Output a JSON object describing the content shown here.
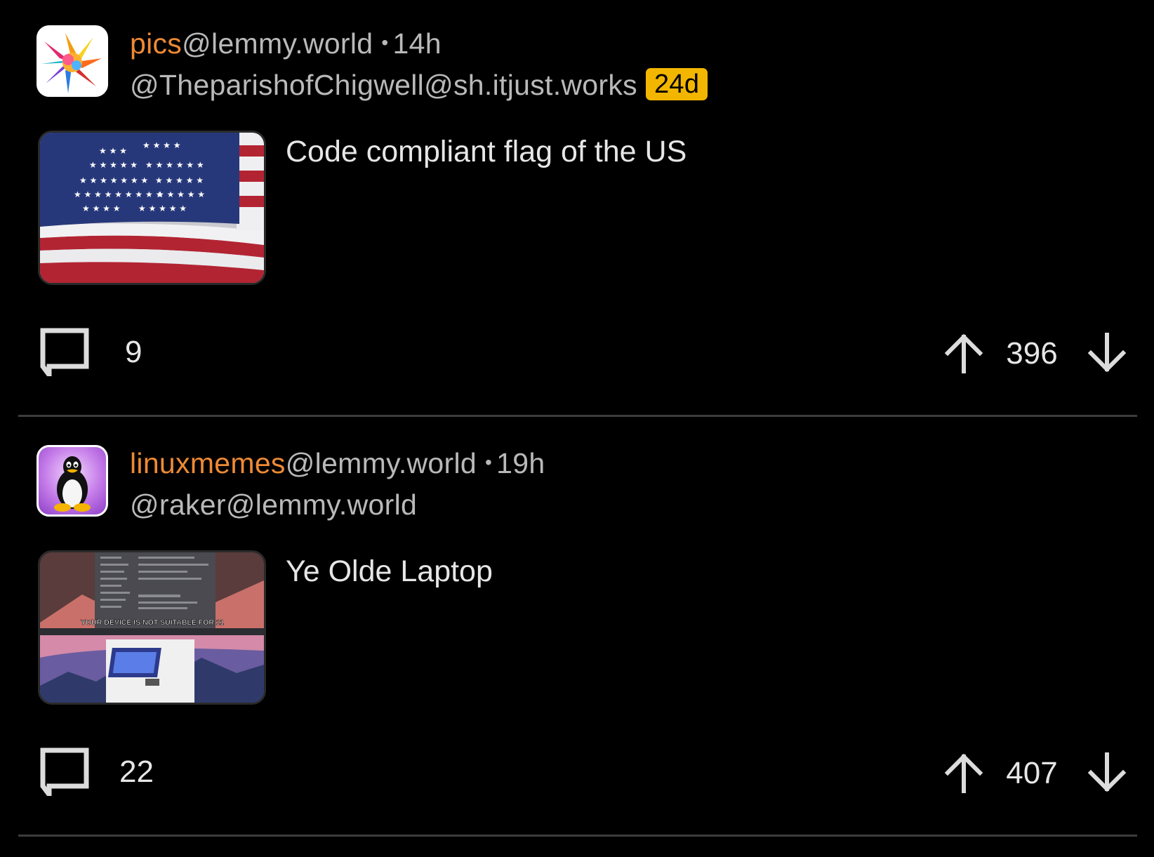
{
  "posts": [
    {
      "community": "pics",
      "instance": "@lemmy.world",
      "separator": "•",
      "age": "14h",
      "user": "@TheparishofChigwell@sh.itjust.works",
      "user_badge": "24d",
      "title": "Code compliant flag of the US",
      "thumbnail_icon": "us-flag-thumbnail",
      "comment_count": "9",
      "score": "396"
    },
    {
      "community": "linuxmemes",
      "instance": "@lemmy.world",
      "separator": "•",
      "age": "19h",
      "user": "@raker@lemmy.world",
      "title": "Ye Olde Laptop",
      "thumbnail_icon": "laptop-meme-thumbnail",
      "thumbnail_caption": "YOUR DEVICE IS NOT SUITABLE FOR 11",
      "comment_count": "22",
      "score": "407"
    }
  ],
  "colors": {
    "background": "#000000",
    "community_accent": "#ee8a35",
    "muted_text": "#b9b9b9",
    "badge": "#f2b600",
    "divider": "#3c3c3c",
    "icon": "#dcdcdc"
  }
}
